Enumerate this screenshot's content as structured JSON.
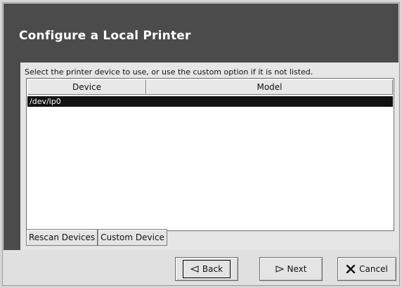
{
  "header": {
    "title": "Configure a Local Printer"
  },
  "main": {
    "instruction": "Select the printer device to use, or use the custom option if it is not listed.",
    "columns": [
      "Device",
      "Model"
    ],
    "rows": [
      {
        "device": "/dev/lp0",
        "model": ""
      }
    ],
    "rescan_label": "Rescan Devices",
    "custom_label": "Custom Device"
  },
  "footer": {
    "back_label": "Back",
    "next_label": "Next",
    "cancel_label": "Cancel"
  },
  "icons": {
    "back": "back-arrow-icon",
    "next": "next-arrow-icon",
    "cancel": "cancel-x-icon"
  },
  "colors": {
    "header_band": "#4b4b4b",
    "selected_row": "#111111",
    "window_bg": "#e0e0e0"
  }
}
